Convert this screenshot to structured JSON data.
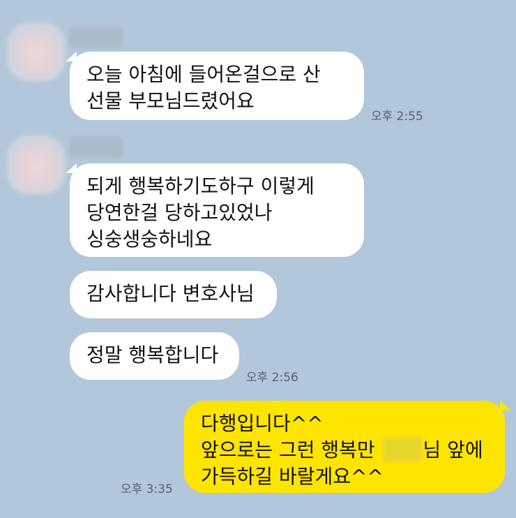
{
  "chat": {
    "groups": [
      {
        "messages": [
          {
            "lines": [
              "오늘 아침에 들어온걸으로 산",
              "선물 부모님드렸어요"
            ]
          }
        ],
        "time": "오후 2:55"
      },
      {
        "messages": [
          {
            "lines": [
              "되게 행복하기도하구 이렇게",
              "당연한걸 당하고있었나",
              "싱숭생숭하네요"
            ]
          },
          {
            "lines": [
              "감사합니다 변호사님"
            ]
          },
          {
            "lines": [
              "정말 행복합니다"
            ]
          }
        ],
        "time": "오후 2:56"
      }
    ],
    "mine": {
      "line1": "다행입니다^^",
      "line2_prefix": "앞으로는 그런 행복만 ",
      "line2_suffix": "님 앞에",
      "line3": "가득하길 바랄게요^^",
      "time": "오후 3:35"
    }
  },
  "colors": {
    "background": "#b2c7d9",
    "incoming_bubble": "#ffffff",
    "outgoing_bubble": "#fee500"
  }
}
